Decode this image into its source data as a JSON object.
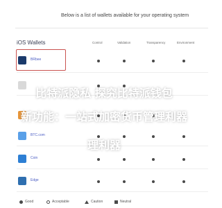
{
  "header": {
    "text": "Below is a list of wallets available for your operating system"
  },
  "section": {
    "title": "iOS Wallets"
  },
  "columns": [
    "Control",
    "Validation",
    "Transparency",
    "Environment"
  ],
  "wallets": [
    {
      "name": "BRbee",
      "color": "#1b3a6b",
      "dots": [
        true,
        true,
        true,
        true
      ]
    },
    {
      "name": "",
      "color": "#d9d9d9",
      "dots": [
        true,
        true,
        false,
        false
      ]
    },
    {
      "name": "",
      "color": "#e8963a",
      "dots": [
        true,
        true,
        true,
        true
      ]
    },
    {
      "name": "BTC.com",
      "color": "#5aa0e8",
      "dots": [
        true,
        true,
        true,
        true
      ]
    },
    {
      "name": "Coin",
      "color": "#2d7fd4",
      "dots": [
        true,
        true,
        true,
        true
      ]
    },
    {
      "name": "Edge",
      "color": "#2f6fb0",
      "dots": [
        true,
        true,
        true,
        true
      ]
    }
  ],
  "overlay": {
    "line1": "比特派隐私 探究比特派钱包",
    "line2": "新功能：一站式加密货币管理利器",
    "line3": "理利器"
  },
  "legend": [
    {
      "label": "Good",
      "icon": "check-icon"
    },
    {
      "label": "Acceptable",
      "icon": "acceptable-icon"
    },
    {
      "label": "Caution",
      "icon": "caution-icon"
    },
    {
      "label": "Neutral",
      "icon": "neutral-icon"
    }
  ]
}
